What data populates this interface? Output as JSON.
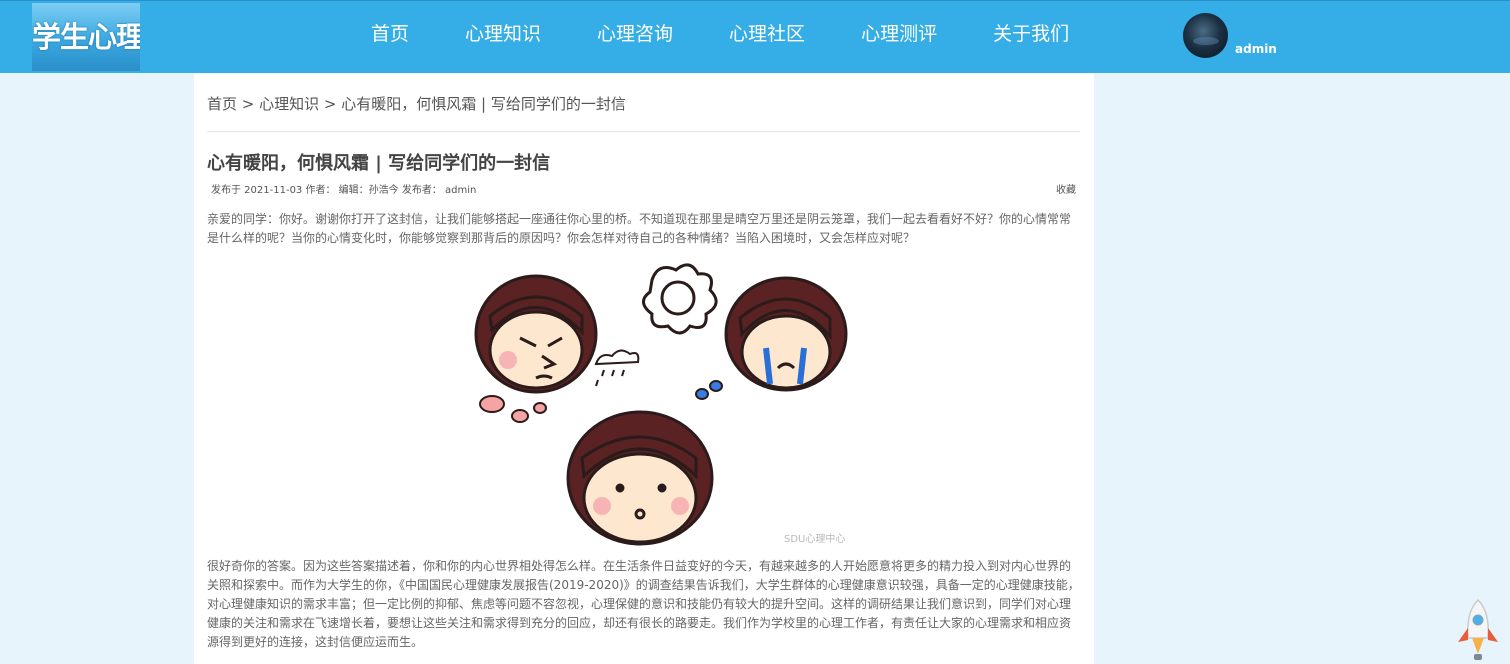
{
  "header": {
    "logo_text": "学生心理健康",
    "nav": [
      "首页",
      "心理知识",
      "心理咨询",
      "心理社区",
      "心理测评",
      "关于我们"
    ],
    "username": "admin"
  },
  "article": {
    "breadcrumb": {
      "home": "首页",
      "sep1": " > ",
      "section": "心理知识",
      "sep2": " > ",
      "current": "心有暖阳，何惧风霜 | 写给同学们的一封信"
    },
    "title": "心有暖阳，何惧风霜 | 写给同学们的一封信",
    "meta": "发布于 2021-11-03 作者：  编辑：孙浩今 发布者：  admin",
    "favorite_label": "收藏",
    "paragraph1": "亲爱的同学：你好。谢谢你打开了这封信，让我们能够搭起一座通往你心里的桥。不知道现在那里是晴空万里还是阴云笼罩，我们一起去看看好不好？你的心情常常是什么样的呢？当你的心情变化时，你能够觉察到那背后的原因吗？你会怎样对待自己的各种情绪？当陷入困境时，又会怎样应对呢？",
    "image_watermark": "SDU心理中心",
    "paragraph2": "很好奇你的答案。因为这些答案描述着，你和你的内心世界相处得怎么样。在生活条件日益变好的今天，有越来越多的人开始愿意将更多的精力投入到对内心世界的关照和探索中。而作为大学生的你，《中国国民心理健康发展报告(2019-2020)》的调查结果告诉我们，大学生群体的心理健康意识较强，具备一定的心理健康技能，对心理健康知识的需求丰富；但一定比例的抑郁、焦虑等问题不容忽视，心理保健的意识和技能仍有较大的提升空间。这样的调研结果让我们意识到，同学们对心理健康的关注和需求在飞速增长着，要想让这些关注和需求得到充分的回应，却还有很长的路要走。我们作为学校里的心理工作者，有责任让大家的心理需求和相应资源得到更好的连接，这封信便应运而生。"
  },
  "icons": {
    "avatar": "avatar-image",
    "rocket": "back-to-top-rocket-icon"
  },
  "colors": {
    "header_bg": "#35ade6",
    "page_bg": "#e8f4fc",
    "content_bg": "#ffffff",
    "text": "#666666"
  }
}
